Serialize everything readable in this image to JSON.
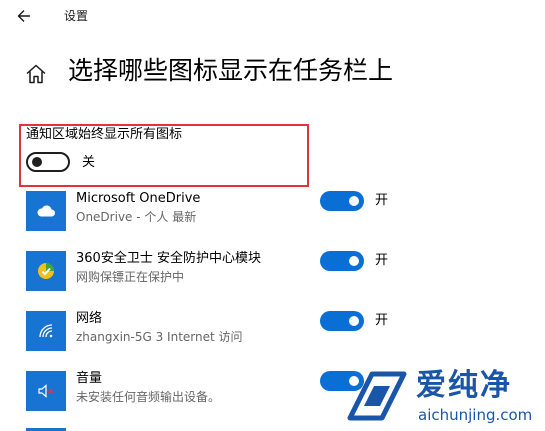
{
  "window": {
    "title": "设置"
  },
  "page": {
    "title": "选择哪些图标显示在任务栏上"
  },
  "notify": {
    "label": "通知区域始终显示所有图标",
    "toggle_state": "关"
  },
  "apps": [
    {
      "name": "Microsoft OneDrive",
      "subtitle": "OneDrive - 个人 最新",
      "state": "开",
      "icon": "cloud-icon"
    },
    {
      "name": "360安全卫士 安全防护中心模块",
      "subtitle": "网购保镖正在保护中",
      "state": "开",
      "icon": "360-shield-icon"
    },
    {
      "name": "网络",
      "subtitle": "zhangxin-5G 3 Internet 访问",
      "state": "开",
      "icon": "wifi-icon"
    },
    {
      "name": "音量",
      "subtitle": "未安装任何音频输出设备。",
      "state": "开",
      "icon": "speaker-muted-icon"
    }
  ],
  "watermark": {
    "name": "爱纯净",
    "domain": "aichunjing.com"
  },
  "colors": {
    "accent": "#0a6fd4",
    "tile": "#1774d2",
    "highlight": "#e0333c"
  }
}
